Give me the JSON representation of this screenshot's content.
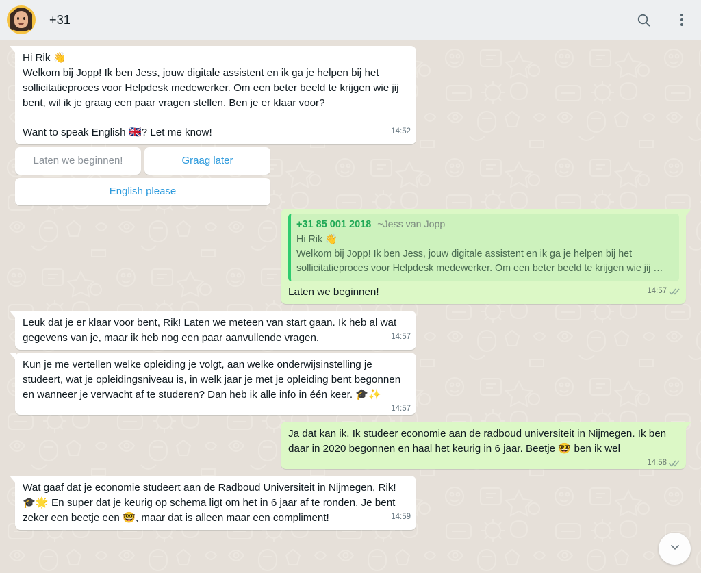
{
  "header": {
    "title": "+31",
    "avatar_icon": "memoji-avatar",
    "search_icon": "search-icon",
    "menu_icon": "overflow-menu-icon",
    "accent_color": "#f5c242"
  },
  "colors": {
    "chat_background": "#e6e0d9",
    "incoming_bubble": "#ffffff",
    "outgoing_bubble": "#dcf8c6",
    "quote_background": "#cdf2bd",
    "quote_bar": "#2ecc6f",
    "link_blue": "#2f9bdd",
    "quote_number_green": "#1fa855",
    "timestamp_gray": "#667781"
  },
  "messages": [
    {
      "id": "msg-welcome",
      "direction": "incoming",
      "line1": "Hi Rik 👋",
      "line2": "Welkom bij Jopp! Ik ben Jess, jouw digitale assistent en ik ga je helpen bij het sollicitatieproces voor Helpdesk medewerker. Om een beter beeld te krijgen wie jij bent, wil ik je graag een paar vragen stellen. Ben je er klaar voor?",
      "line3": "Want to speak English 🇬🇧? Let me know!",
      "time": "14:52",
      "ticks": "none"
    },
    {
      "id": "msg-ready",
      "direction": "outgoing",
      "quote": {
        "number": "+31 85 001 2018",
        "name": "~Jess van Jopp",
        "line1": "Hi Rik 👋",
        "line2": "Welkom bij Jopp! Ik ben Jess, jouw digitale assistent en ik ga je helpen bij het sollicitatieproces voor Helpdesk medewerker. Om een beter beeld te krijgen wie jij …"
      },
      "text": "Laten we beginnen!",
      "time": "14:57",
      "ticks": "double"
    },
    {
      "id": "msg-start",
      "direction": "incoming",
      "text": "Leuk dat je er klaar voor bent, Rik! Laten we meteen van start gaan. Ik heb al wat gegevens van je, maar ik heb nog een paar aanvullende vragen.",
      "time": "14:57",
      "ticks": "none"
    },
    {
      "id": "msg-question-education",
      "direction": "incoming",
      "text": "Kun je me vertellen welke opleiding je volgt, aan welke onderwijsinstelling je studeert, wat je opleidingsniveau is, in welk jaar je met je opleiding bent begonnen en wanneer je verwacht af te studeren? Dan heb ik alle info in één keer. 🎓✨",
      "time": "14:57",
      "ticks": "none"
    },
    {
      "id": "msg-answer-education",
      "direction": "outgoing",
      "text": "Ja dat kan ik. Ik studeer economie aan de radboud universiteit in Nijmegen. Ik ben daar in 2020 begonnen en haal het keurig in 6 jaar. Beetje 🤓 ben ik wel",
      "time": "14:58",
      "ticks": "double"
    },
    {
      "id": "msg-compliment",
      "direction": "incoming",
      "text": "Wat gaaf dat je economie studeert aan de Radboud Universiteit in Nijmegen, Rik! 🎓🌟 En super dat je keurig op schema ligt om het in 6 jaar af te ronden. Je bent zeker een beetje een 🤓, maar dat is alleen maar een compliment!",
      "time": "14:59",
      "ticks": "none"
    }
  ],
  "quick_replies": {
    "row1": [
      {
        "label": "Laten we beginnen!",
        "state": "used"
      },
      {
        "label": "Graag later",
        "state": "active"
      }
    ],
    "row2": [
      {
        "label": "English please",
        "state": "active"
      }
    ]
  },
  "scroll_button": {
    "icon": "chevron-down-icon"
  }
}
